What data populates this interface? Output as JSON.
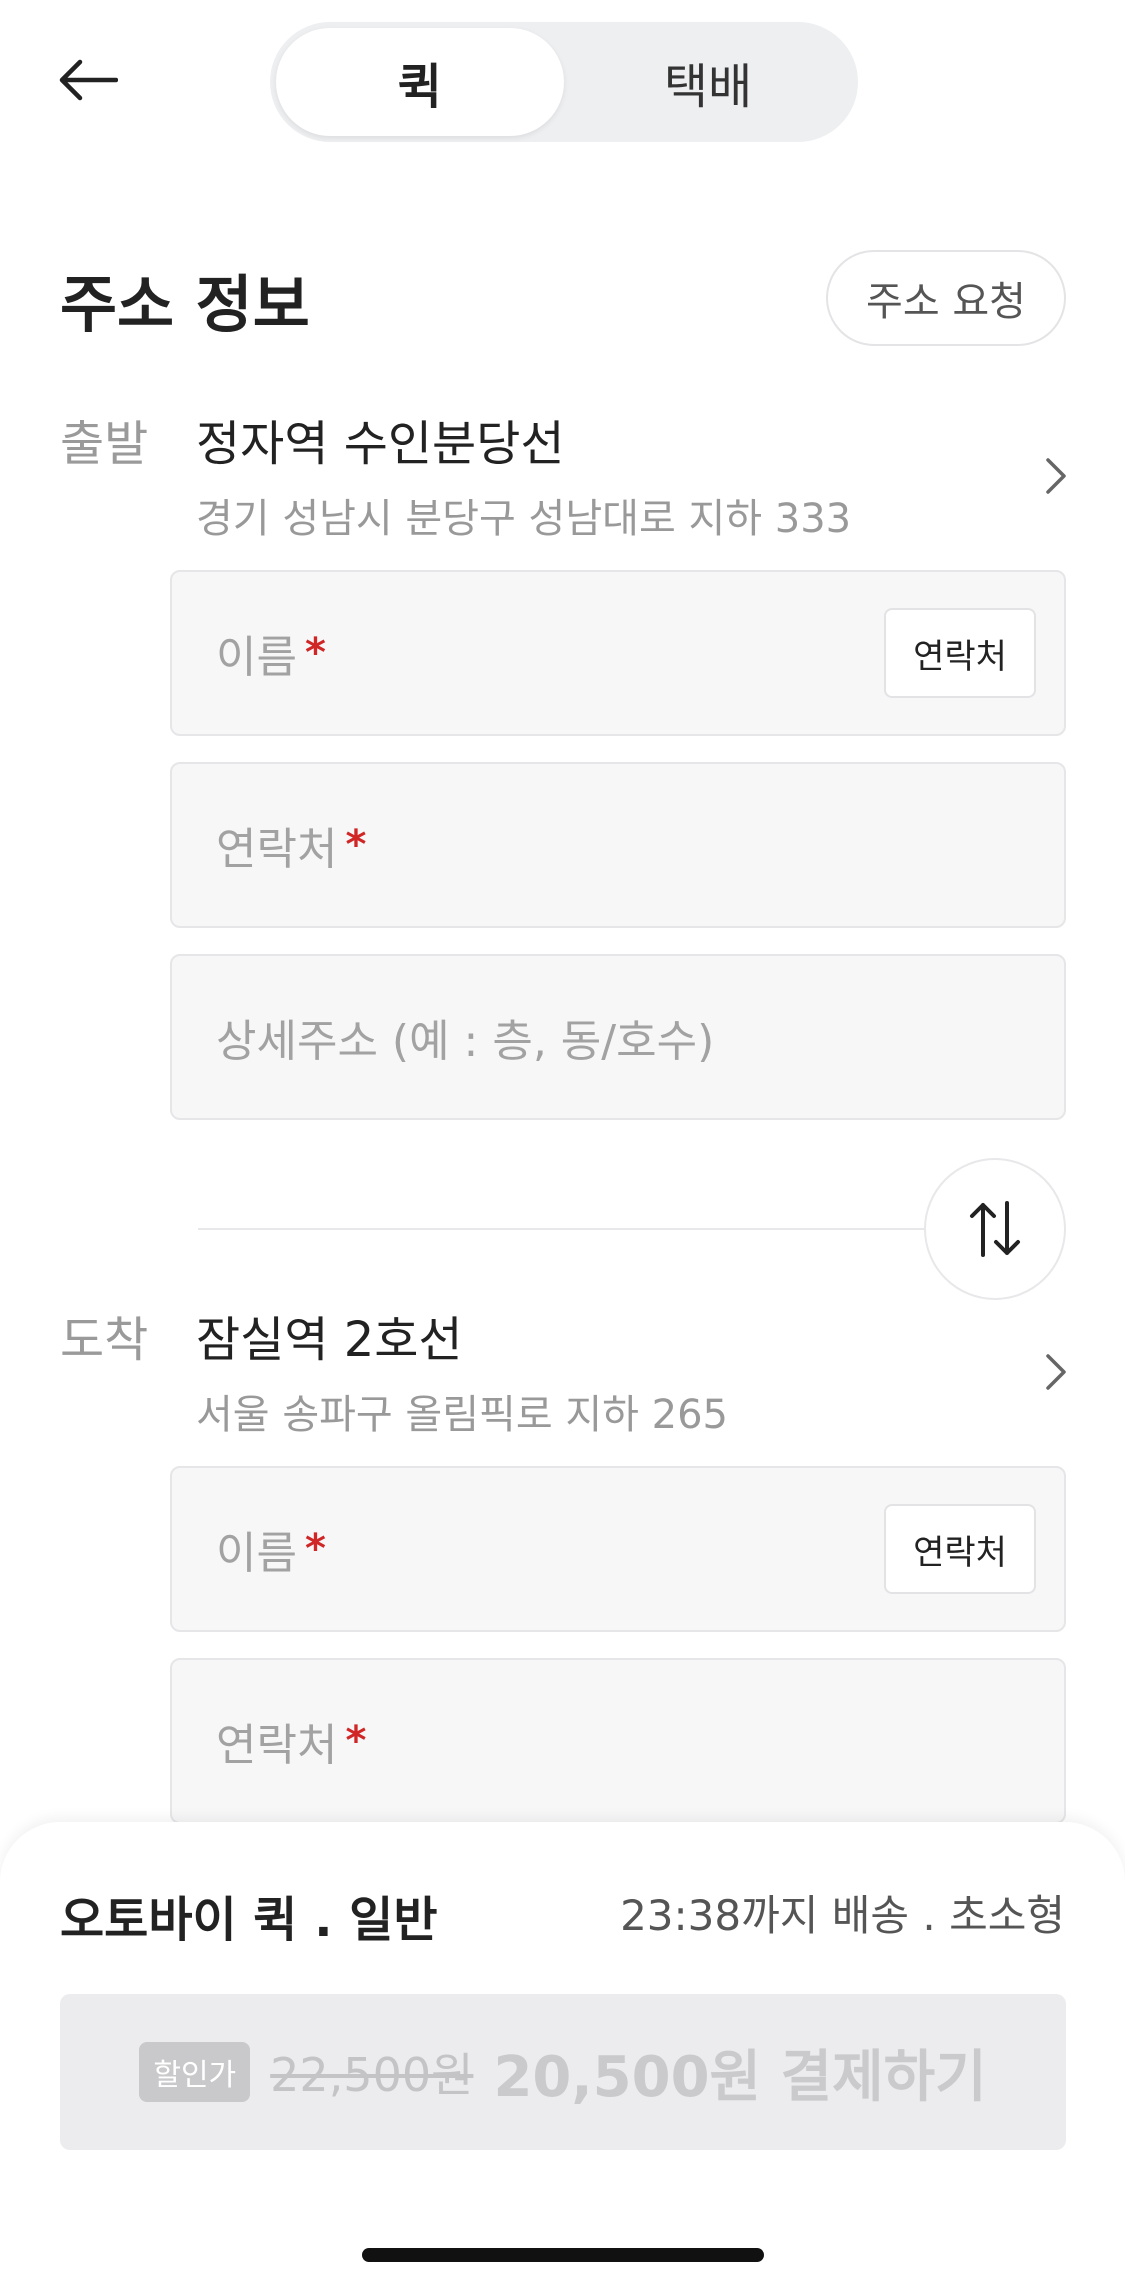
{
  "header": {
    "tabs": [
      {
        "label": "퀵",
        "active": true
      },
      {
        "label": "택배",
        "active": false
      }
    ]
  },
  "section": {
    "title": "주소 정보",
    "request_button": "주소 요청"
  },
  "departure": {
    "label": "출발",
    "name": "정자역 수인분당선",
    "address": "경기 성남시 분당구 성남대로 지하 333",
    "name_placeholder": "이름",
    "contact_placeholder": "연락처",
    "detail_placeholder": "상세주소 (예 : 층, 동/호수)",
    "contacts_button": "연락처",
    "required_mark": "*"
  },
  "arrival": {
    "label": "도착",
    "name": "잠실역 2호선",
    "address": "서울 송파구 올림픽로 지하 265",
    "name_placeholder": "이름",
    "contact_placeholder": "연락처",
    "contacts_button": "연락처",
    "required_mark": "*"
  },
  "sheet": {
    "service_name": "오토바이 퀵 . 일반",
    "service_info": "23:38까지 배송 . 초소형",
    "discount_badge": "할인가",
    "old_price": "22,500원",
    "pay_label": "20,500원 결제하기"
  },
  "colors": {
    "required": "#d02626",
    "pay_disabled_bg": "#ececee",
    "segment_bg": "#eeeff1"
  }
}
